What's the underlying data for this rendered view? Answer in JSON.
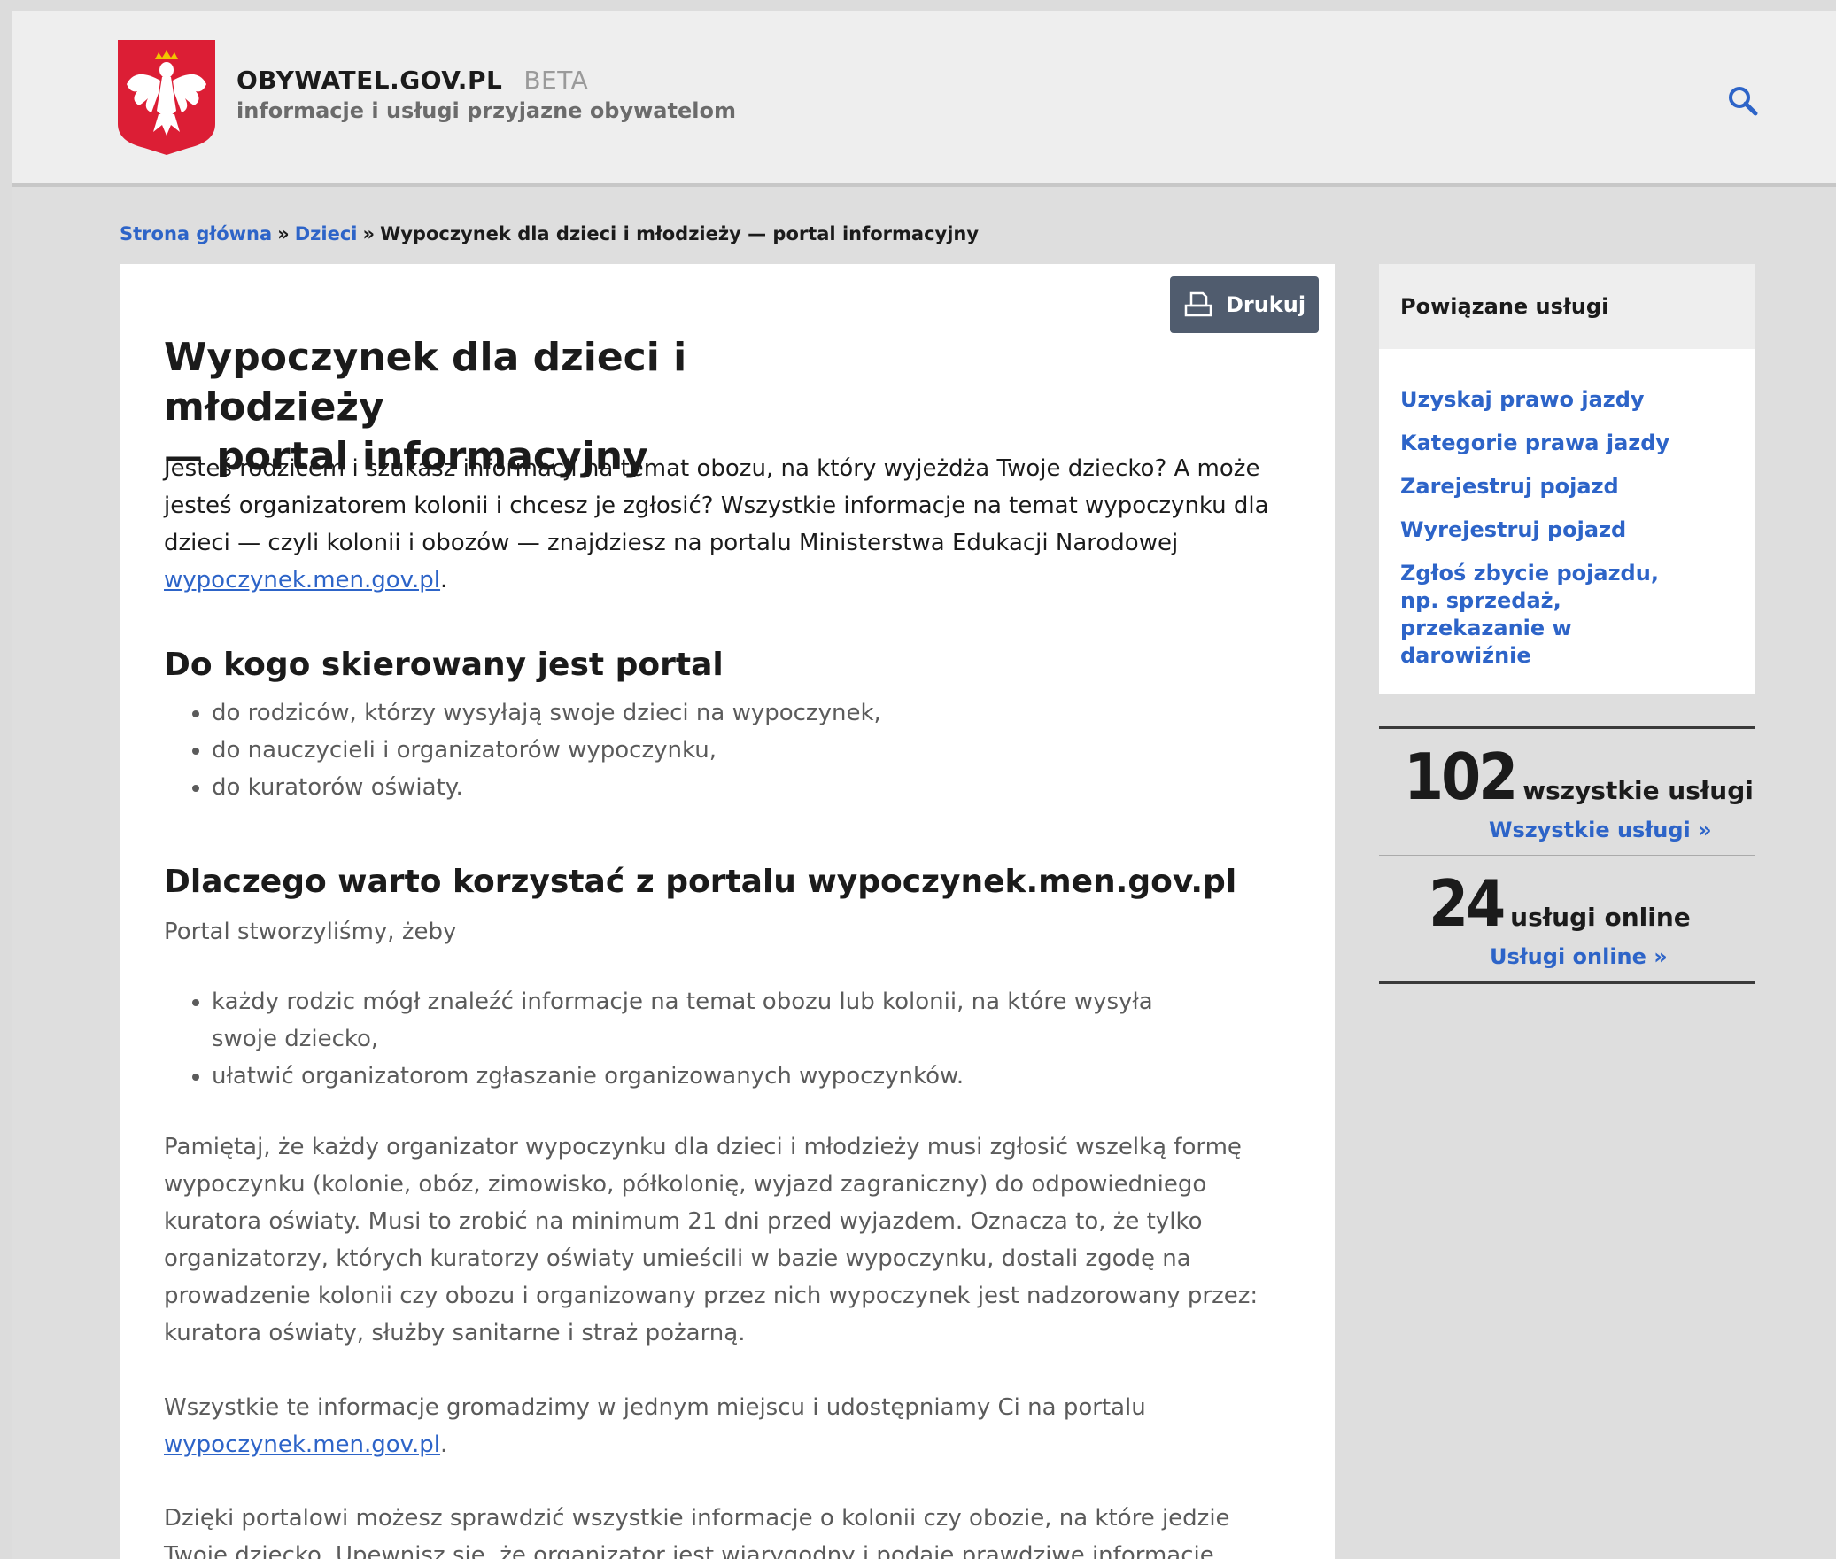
{
  "header": {
    "brand": "OBYWATEL.GOV.PL",
    "beta": "BETA",
    "tagline": "informacje i usługi przyjazne obywatelom"
  },
  "breadcrumb": {
    "home": "Strona główna",
    "sep": "»",
    "category": "Dzieci",
    "current": "Wypoczynek dla dzieci i młodzieży — portal informacyjny"
  },
  "print_button": "Drukuj",
  "article": {
    "title_line1": "Wypoczynek dla dzieci i młodzieży",
    "title_line2": "— portal informacyjny",
    "intro": "Jesteś rodzicem i szukasz informacji na temat obozu, na który wyjeżdża Twoje dziecko? A może jesteś organizatorem kolonii i chcesz je zgłosić? Wszystkie informacje na temat wypoczynku dla dzieci — czyli kolonii i obozów — znajdziesz na portalu Ministerstwa Edukacji Narodowej",
    "intro_link": "wypoczynek.men.gov.pl",
    "section1_title": "Do kogo skierowany jest portal",
    "section1_items": [
      "do rodziców, którzy wysyłają swoje dzieci na wypoczynek,",
      "do nauczycieli i organizatorów wypoczynku,",
      "do kuratorów oświaty."
    ],
    "section2_title": "Dlaczego warto korzystać z portalu wypoczynek.men.gov.pl",
    "section2_lead": "Portal stworzyliśmy, żeby",
    "section2_items": [
      "każdy rodzic mógł znaleźć informacje na temat obozu lub kolonii, na które wysyła swoje dziecko,",
      "ułatwić organizatorom zgłaszanie organizowanych wypoczynków."
    ],
    "para1": "Pamiętaj, że każdy organizator wypoczynku dla dzieci i młodzieży musi zgłosić wszelką formę wypoczynku (kolonie, obóz, zimowisko, półkolonię, wyjazd zagraniczny) do odpowiedniego kuratora oświaty. Musi to zrobić na minimum 21 dni przed wyjazdem. Oznacza to, że tylko organizatorzy, których kuratorzy oświaty umieścili w bazie wypoczynku, dostali zgodę na prowadzenie kolonii czy obozu i organizowany przez nich wypoczynek jest nadzorowany przez: kuratora oświaty, służby sanitarne i straż pożarną.",
    "para2": "Wszystkie te informacje gromadzimy w jednym miejscu i udostępniamy Ci na portalu",
    "para2_link": "wypoczynek.men.gov.pl",
    "para3": "Dzięki portalowi możesz sprawdzić wszystkie informacje o kolonii czy obozie, na które jedzie Twoje dziecko. Upewnisz się, że organizator jest wiarygodny i podaje prawdziwe informacje."
  },
  "sidebar": {
    "title": "Powiązane usługi",
    "links": [
      "Uzyskaj prawo jazdy",
      "Kategorie prawa jazdy",
      "Zarejestruj pojazd",
      "Wyrejestruj pojazd",
      "Zgłoś zbycie pojazdu, np. sprzedaż, przekazanie w darowiźnie"
    ]
  },
  "stats": [
    {
      "number": "102",
      "label": "wszystkie usługi",
      "link": "Wszystkie usługi »"
    },
    {
      "number": "24",
      "label": "usługi online",
      "link": "Usługi online »"
    }
  ],
  "colors": {
    "link": "#2d64c8",
    "print_button": "#505c6e",
    "emblem_red": "#dc1e35"
  }
}
